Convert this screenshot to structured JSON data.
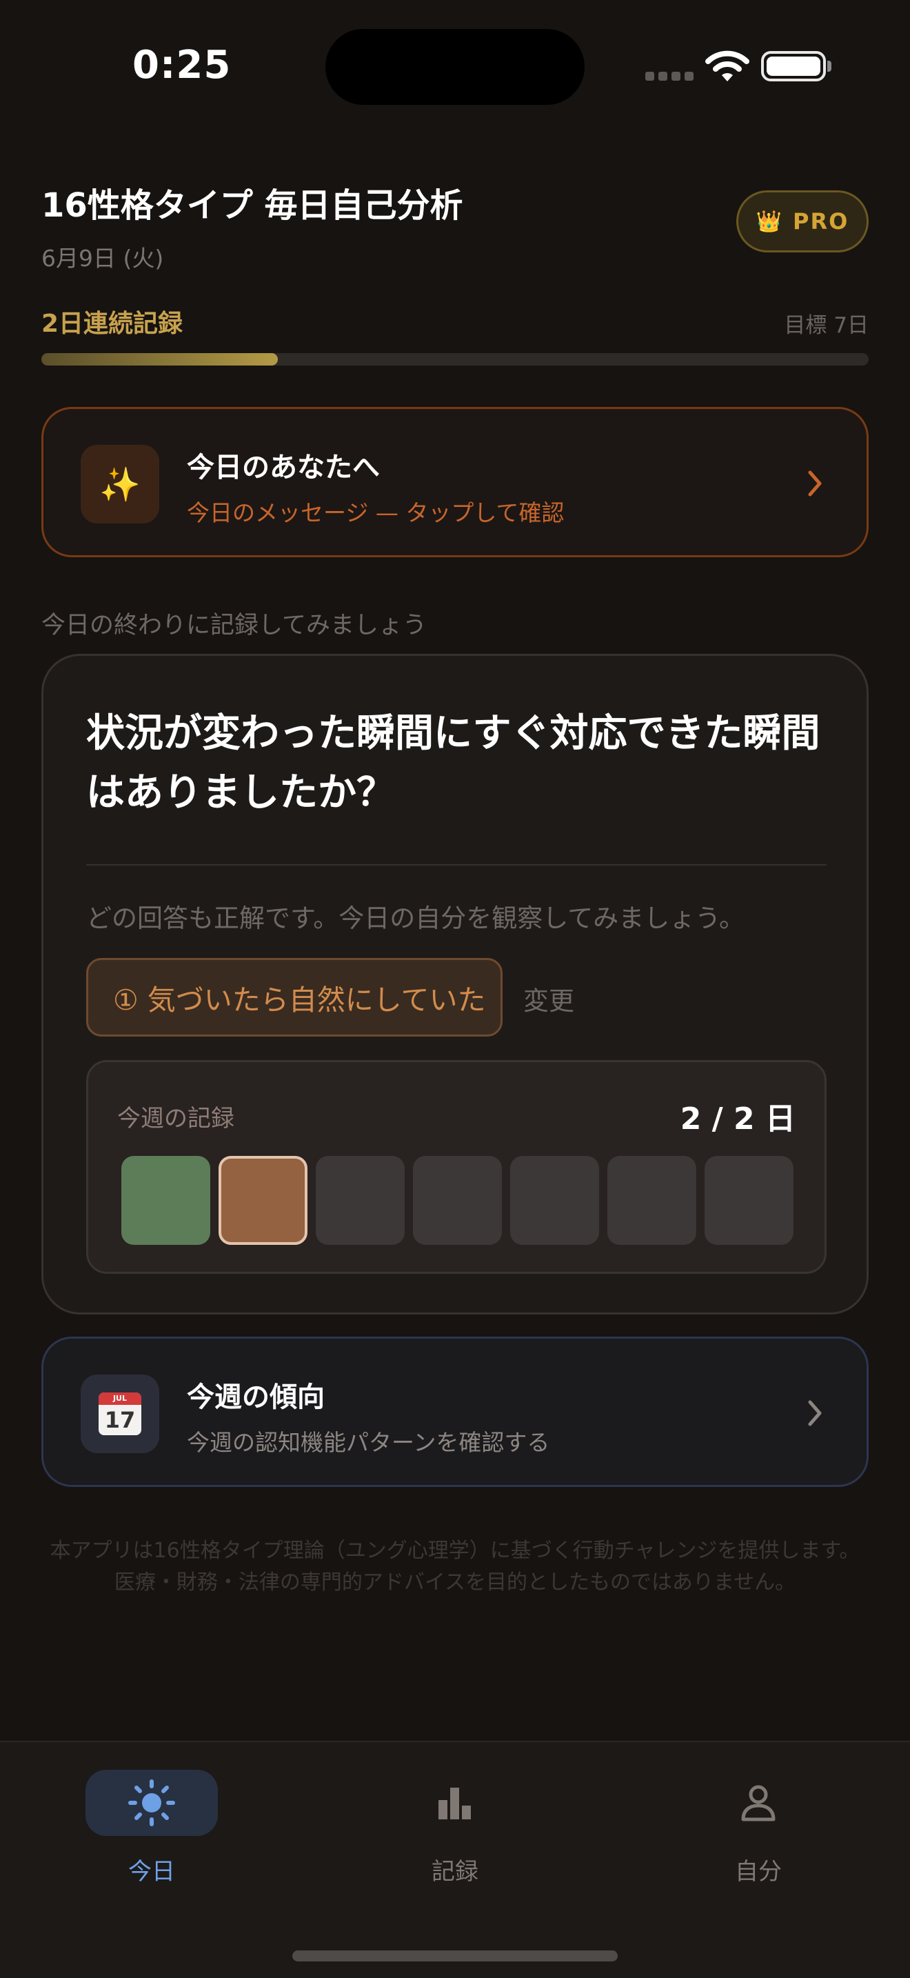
{
  "status_bar": {
    "time": "0:25"
  },
  "header": {
    "title": "16性格タイプ 毎日自己分析",
    "date": "6月9日 (火)",
    "pro_label": "PRO"
  },
  "streak": {
    "label": "2日連続記録",
    "goal": "目標 7日",
    "progress_fraction": 0.286
  },
  "message_card": {
    "title": "今日のあなたへ",
    "subtitle": "今日のメッセージ — タップして確認",
    "icon": "sparkles-icon"
  },
  "prompt_label": "今日の終わりに記録してみましょう",
  "question_card": {
    "question": "状況が変わった瞬間にすぐ対応できた瞬間はありましたか？",
    "hint": "どの回答も正解です。今日の自分を観察してみましょう。",
    "selected_answer": "① 気づいたら自然にしていた",
    "change_label": "変更",
    "week": {
      "label": "今週の記録",
      "count": "2 / 2 日",
      "days": [
        "green",
        "brown",
        "empty",
        "empty",
        "empty",
        "empty",
        "empty"
      ]
    }
  },
  "trend_card": {
    "title": "今週の傾向",
    "subtitle": "今週の認知機能パターンを確認する",
    "icon": "calendar-icon",
    "icon_month": "JUL",
    "icon_day": "17"
  },
  "disclaimer": {
    "line1": "本アプリは16性格タイプ理論（ユング心理学）に基づく行動チャレンジを提供します。",
    "line2": "医療・財務・法律の専門的アドバイスを目的としたものではありません。"
  },
  "tabs": [
    {
      "label": "今日",
      "icon": "sun-icon",
      "active": true
    },
    {
      "label": "記録",
      "icon": "bar-chart-icon",
      "active": false
    },
    {
      "label": "自分",
      "icon": "person-icon",
      "active": false
    }
  ],
  "colors": {
    "accent_gold": "#c8a24e",
    "accent_orange": "#c8652b",
    "tab_active": "#6ea0e6",
    "day_green": "#5d7c58",
    "day_brown": "#946240"
  }
}
